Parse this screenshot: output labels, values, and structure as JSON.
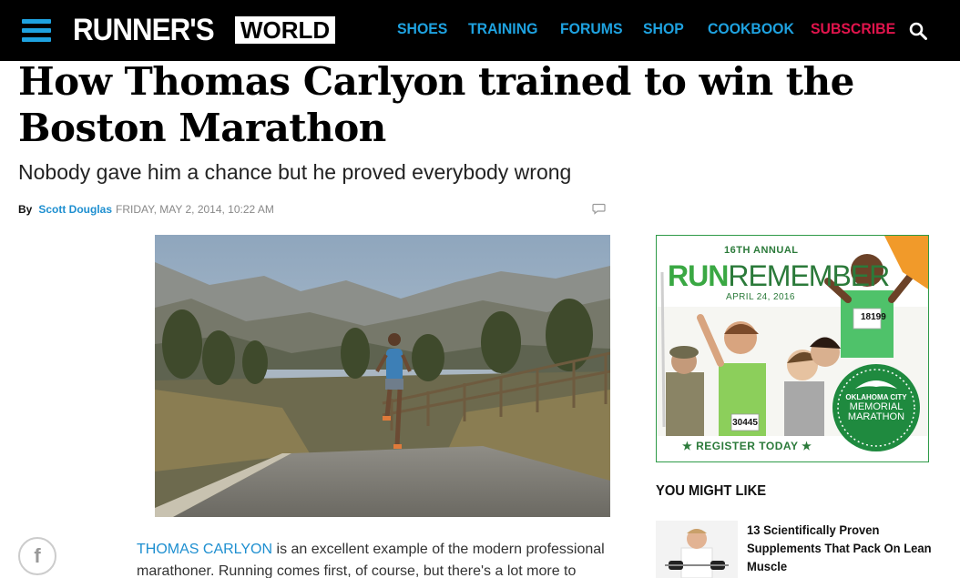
{
  "header": {
    "logo_main": "RUNNER'S",
    "logo_box": "WORLD",
    "menu_icon": "hamburger-menu-icon",
    "search_icon": "search-icon",
    "nav_items": [
      {
        "label": "SHOES"
      },
      {
        "label": "TRAINING"
      },
      {
        "label": "FORUMS"
      },
      {
        "label": "SHOP"
      },
      {
        "label": "COOKBOOK"
      },
      {
        "label": "SUBSCRIBE"
      }
    ],
    "accent_color": "#1ea2e0",
    "subscribe_color": "#e0144c"
  },
  "article": {
    "headline": "How Thomas Carlyon trained to win the Boston Marathon",
    "dek": "Nobody gave him a chance but he proved everybody wrong",
    "by_label": "By",
    "author": "Scott Douglas",
    "date": "FRIDAY, MAY 2, 2014, 10:22 AM",
    "comment_icon": "comment-bubble-icon",
    "social_icon": "facebook-icon",
    "social_glyph": "f",
    "body_link": "THOMAS CARLYON",
    "body_rest": " is an excellent example of the modern professional marathoner. Running comes first, of course, but there's a lot more to"
  },
  "sidebar": {
    "ad": {
      "annual": "16TH ANNUAL",
      "title_run": "RUN",
      "title_remember": "REMEMBER",
      "date": "APRIL 24, 2016",
      "bib_1": "18199",
      "bib_2": "30445",
      "badge_line1": "OKLAHOMA CITY",
      "badge_line2": "MEMORIAL",
      "badge_line3": "MARATHON",
      "register": "★ REGISTER TODAY ★",
      "brand_color": "#2b7a3a"
    },
    "you_might_like": "YOU MIGHT LIKE",
    "recommendations": [
      {
        "title": "13 Scientifically Proven Supplements That Pack On Lean Muscle"
      }
    ]
  }
}
